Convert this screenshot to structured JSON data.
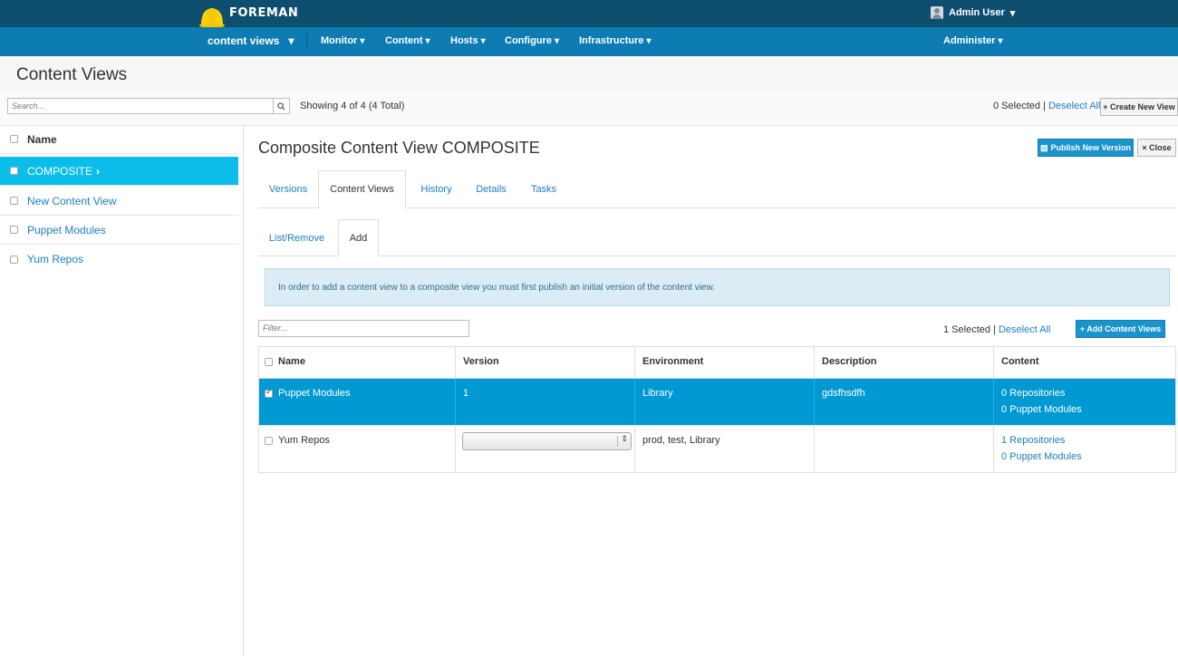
{
  "brand": "FOREMAN",
  "user": {
    "name": "Admin User",
    "caret": "▾"
  },
  "nav": {
    "context": "content views",
    "items": [
      "Monitor",
      "Content",
      "Hosts",
      "Configure",
      "Infrastructure"
    ],
    "administer": "Administer",
    "caret": "▾"
  },
  "page": {
    "title": "Content Views"
  },
  "toolbar": {
    "search_placeholder": "Search...",
    "showing": "Showing 4 of 4 (4 Total)",
    "selected": "0 Selected",
    "separator": "|",
    "deselect_all": "Deselect All",
    "create_button": "+ Create New View"
  },
  "list": {
    "header": "Name",
    "items": [
      {
        "label": "COMPOSITE",
        "selected": true
      },
      {
        "label": "New Content View",
        "selected": false
      },
      {
        "label": "Puppet Modules",
        "selected": false
      },
      {
        "label": "Yum Repos",
        "selected": false
      }
    ]
  },
  "details": {
    "title": "Composite Content View COMPOSITE",
    "publish_button": "Publish New Version",
    "close_button": "× Close",
    "tabs": [
      "Versions",
      "Content Views",
      "History",
      "Details",
      "Tasks"
    ],
    "active_tab": "Content Views",
    "subtabs": [
      "List/Remove",
      "Add"
    ],
    "active_subtab": "Add",
    "alert": "In order to add a content view to a composite view you must first publish an initial version of the content view.",
    "filter_placeholder": "Filter...",
    "selected": "1 Selected",
    "separator": "|",
    "deselect_all": "Deselect All",
    "add_button": "+ Add Content Views"
  },
  "table": {
    "columns": [
      "Name",
      "Version",
      "Environment",
      "Description",
      "Content"
    ],
    "rows": [
      {
        "name": "Puppet Modules",
        "checked": true,
        "version": "1",
        "environment": "Library",
        "description": "gdsfhsdfh",
        "repositories": "0 Repositories",
        "puppet_modules": "0 Puppet Modules"
      },
      {
        "name": "Yum Repos",
        "checked": false,
        "version": "",
        "environment": "prod, test, Library",
        "description": "",
        "repositories": "1 Repositories",
        "puppet_modules": "0 Puppet Modules"
      }
    ]
  },
  "colors": {
    "topbar": "#0e4f6f",
    "navbar": "#0d7cb3",
    "selected_list": "#0bbde9",
    "selected_row": "#0099d3",
    "link": "#1a7fbf"
  }
}
